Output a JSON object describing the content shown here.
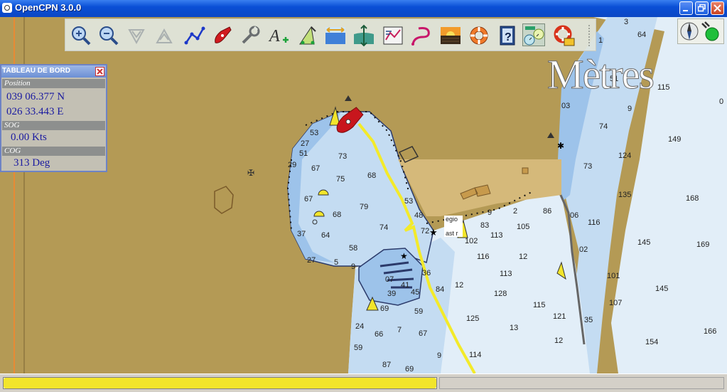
{
  "window": {
    "title": "OpenCPN 3.0.0"
  },
  "toolbar": {
    "buttons": [
      {
        "name": "zoom-in",
        "icon": "zoom-in-icon"
      },
      {
        "name": "zoom-out",
        "icon": "zoom-out-icon"
      },
      {
        "name": "scale-in",
        "icon": "scale-in-icon"
      },
      {
        "name": "scale-out",
        "icon": "scale-out-icon"
      },
      {
        "name": "route",
        "icon": "route-icon"
      },
      {
        "name": "follow-ship",
        "icon": "ship-icon"
      },
      {
        "name": "settings",
        "icon": "wrench-icon"
      },
      {
        "name": "text",
        "icon": "text-icon"
      },
      {
        "name": "current-tide",
        "icon": "current-tide-icon"
      },
      {
        "name": "tides",
        "icon": "tide-icon"
      },
      {
        "name": "currents",
        "icon": "currents-icon"
      },
      {
        "name": "route-manager",
        "icon": "route-manager-icon"
      },
      {
        "name": "track",
        "icon": "track-icon"
      },
      {
        "name": "color-scheme",
        "icon": "sunset-icon"
      },
      {
        "name": "mob",
        "icon": "lifebuoy-icon"
      },
      {
        "name": "help",
        "icon": "help-icon"
      },
      {
        "name": "dashboard",
        "icon": "dashboard-icon",
        "active": true
      },
      {
        "name": "mob-alarm",
        "icon": "lifering-icon"
      }
    ]
  },
  "compass": {
    "icons": [
      "compass-icon",
      "gps-status-icon"
    ],
    "gps_status_color": "#1fbf3a"
  },
  "chart": {
    "scale_label": "Mètres",
    "callout_top": "egio",
    "callout_bottom": "ast r",
    "soundings": [
      {
        "id": "s1",
        "text": "3"
      },
      {
        "id": "s2",
        "text": "64"
      },
      {
        "id": "s3",
        "text": "1"
      },
      {
        "id": "s4",
        "text": "51"
      },
      {
        "id": "s5",
        "text": "115"
      },
      {
        "id": "s6",
        "text": "0"
      },
      {
        "id": "s7",
        "text": "03"
      },
      {
        "id": "s8",
        "text": "9"
      },
      {
        "id": "s9",
        "text": "74"
      },
      {
        "id": "s10",
        "text": "149"
      },
      {
        "id": "s11",
        "text": "124"
      },
      {
        "id": "s12",
        "text": "73"
      },
      {
        "id": "s13",
        "text": "135"
      },
      {
        "id": "s14",
        "text": "168"
      },
      {
        "id": "s15",
        "text": "116"
      },
      {
        "id": "s16",
        "text": "145"
      },
      {
        "id": "s17",
        "text": "169"
      },
      {
        "id": "s18",
        "text": "101"
      },
      {
        "id": "s19",
        "text": "145"
      },
      {
        "id": "s20",
        "text": "107"
      },
      {
        "id": "s21",
        "text": "35"
      },
      {
        "id": "s22",
        "text": "166"
      },
      {
        "id": "s23",
        "text": "154"
      },
      {
        "id": "s24",
        "text": "53"
      },
      {
        "id": "s25",
        "text": "27"
      },
      {
        "id": "s26",
        "text": "51"
      },
      {
        "id": "s27",
        "text": "29"
      },
      {
        "id": "s28",
        "text": "73"
      },
      {
        "id": "s29",
        "text": "67"
      },
      {
        "id": "s30",
        "text": "75"
      },
      {
        "id": "s31",
        "text": "68"
      },
      {
        "id": "s32",
        "text": "67"
      },
      {
        "id": "s33",
        "text": "79"
      },
      {
        "id": "s34",
        "text": "68"
      },
      {
        "id": "s35",
        "text": "53"
      },
      {
        "id": "s36",
        "text": "48"
      },
      {
        "id": "s37",
        "text": "37"
      },
      {
        "id": "s38",
        "text": "64"
      },
      {
        "id": "s39",
        "text": "74"
      },
      {
        "id": "s40",
        "text": "58"
      },
      {
        "id": "s41",
        "text": "27"
      },
      {
        "id": "s42",
        "text": "5"
      },
      {
        "id": "s43",
        "text": "9"
      },
      {
        "id": "s44",
        "text": "07"
      },
      {
        "id": "s45",
        "text": "41"
      },
      {
        "id": "s46",
        "text": "45"
      },
      {
        "id": "s47",
        "text": "39"
      },
      {
        "id": "s48",
        "text": "69"
      },
      {
        "id": "s49",
        "text": "36"
      },
      {
        "id": "s50",
        "text": "84"
      },
      {
        "id": "s51",
        "text": "12"
      },
      {
        "id": "s52",
        "text": "59"
      },
      {
        "id": "s53",
        "text": "125"
      },
      {
        "id": "s54",
        "text": "13"
      },
      {
        "id": "s55",
        "text": "66"
      },
      {
        "id": "s56",
        "text": "7"
      },
      {
        "id": "s57",
        "text": "67"
      },
      {
        "id": "s58",
        "text": "59"
      },
      {
        "id": "s59",
        "text": "87"
      },
      {
        "id": "s60",
        "text": "69"
      },
      {
        "id": "s61",
        "text": "114"
      },
      {
        "id": "s62",
        "text": "9"
      },
      {
        "id": "s63",
        "text": "102"
      },
      {
        "id": "s64",
        "text": "116"
      },
      {
        "id": "s65",
        "text": "12"
      },
      {
        "id": "s66",
        "text": "113"
      },
      {
        "id": "s67",
        "text": "128"
      },
      {
        "id": "s68",
        "text": "115"
      },
      {
        "id": "s69",
        "text": "121"
      },
      {
        "id": "s70",
        "text": "12"
      },
      {
        "id": "s71",
        "text": "105"
      },
      {
        "id": "s72",
        "text": "113"
      },
      {
        "id": "s73",
        "text": "83"
      },
      {
        "id": "s74",
        "text": "72"
      },
      {
        "id": "s75",
        "text": "9"
      },
      {
        "id": "s76",
        "text": "2"
      },
      {
        "id": "s77",
        "text": "86"
      },
      {
        "id": "s78",
        "text": "06"
      },
      {
        "id": "s79",
        "text": "02"
      },
      {
        "id": "s80",
        "text": "24"
      }
    ]
  },
  "dashboard": {
    "title": "TABLEAU DE BORD",
    "position_label": "Position",
    "latitude": "039 06.377 N",
    "longitude": "026 33.443 E",
    "sog_label": "SOG",
    "sog_value": "0.00 Kts",
    "cog_label": "COG",
    "cog_value": "313 Deg"
  },
  "statusbar": {
    "progress": 1.0,
    "progress_color": "#f2e52b"
  },
  "colors": {
    "land": "#b49a55",
    "shallow": "#9dc3ea",
    "medium": "#c4dcf2",
    "deep": "#e2eef8",
    "track": "#f3ea2a",
    "ship": "#c8161d"
  }
}
